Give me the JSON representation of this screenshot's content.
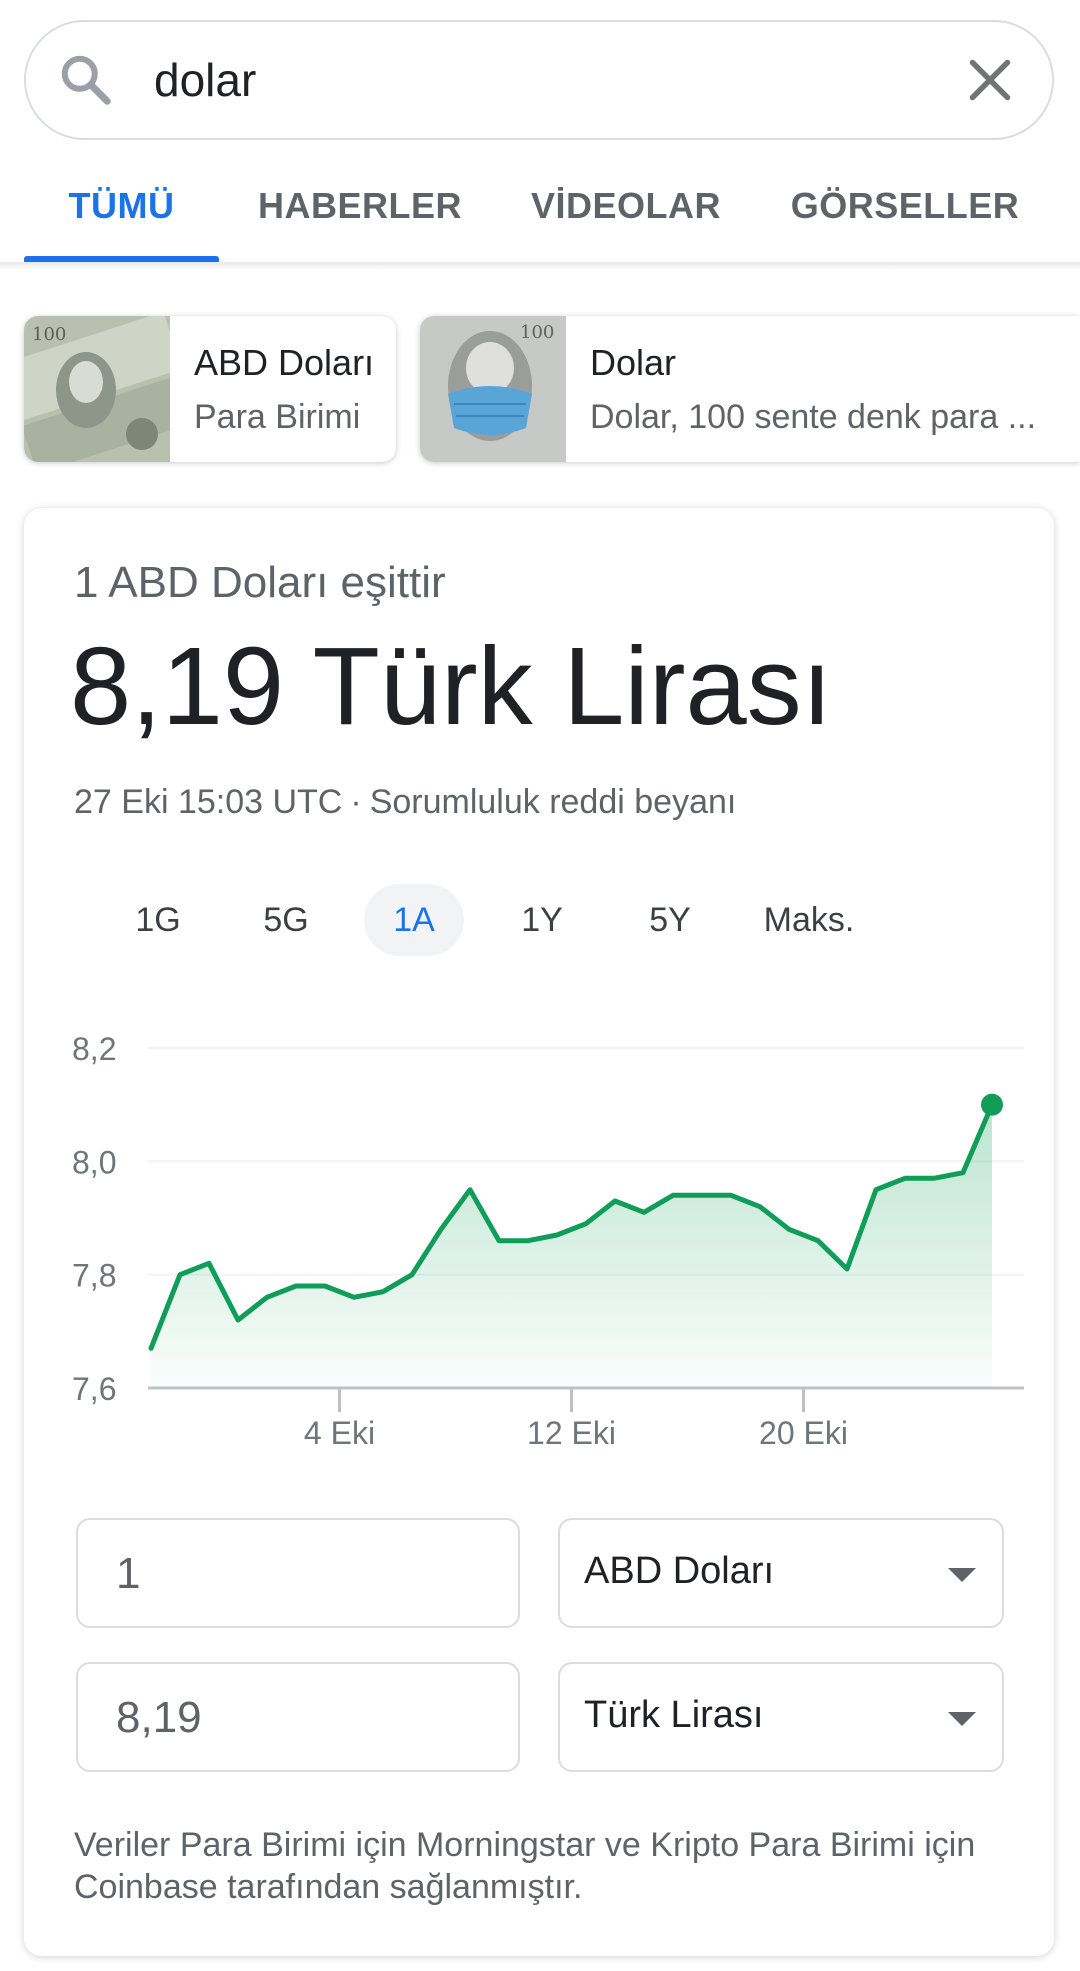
{
  "search": {
    "query": "dolar"
  },
  "tabs": [
    {
      "label": "TÜMÜ",
      "active": true
    },
    {
      "label": "HABERLER",
      "active": false
    },
    {
      "label": "VİDEOLAR",
      "active": false
    },
    {
      "label": "GÖRSELLER",
      "active": false
    }
  ],
  "entities": [
    {
      "title": "ABD Doları",
      "subtitle": "Para Birimi"
    },
    {
      "title": "Dolar",
      "subtitle": "Dolar, 100 sente denk para ..."
    }
  ],
  "converter": {
    "from_line": "1 ABD Doları eşittir",
    "result": "8,19 Türk Lirası",
    "timestamp": "27 Eki 15:03 UTC",
    "separator": "·",
    "disclaimer": "Sorumluluk reddi beyanı",
    "periods": [
      {
        "label": "1G",
        "active": false
      },
      {
        "label": "5G",
        "active": false
      },
      {
        "label": "1A",
        "active": true
      },
      {
        "label": "1Y",
        "active": false
      },
      {
        "label": "5Y",
        "active": false
      },
      {
        "label": "Maks.",
        "active": false
      }
    ],
    "amount_from": "1",
    "currency_from": "ABD Doları",
    "amount_to": "8,19",
    "currency_to": "Türk Lirası",
    "source": "Veriler Para Birimi için Morningstar ve Kripto Para Birimi için Coinbase tarafından sağlanmıştır."
  },
  "colors": {
    "accent": "#1a73e8",
    "chart_line": "#0f9d58"
  },
  "chart_data": {
    "type": "area",
    "title": "",
    "xlabel": "",
    "ylabel": "",
    "ylim": [
      7.6,
      8.2
    ],
    "yticks": [
      "8,2",
      "8,0",
      "7,8",
      "7,6"
    ],
    "ytick_values": [
      8.2,
      8.0,
      7.8,
      7.6
    ],
    "xticks": [
      "4 Eki",
      "12 Eki",
      "20 Eki"
    ],
    "xtick_index": [
      6.5,
      14.5,
      22.5
    ],
    "grid": true,
    "series": [
      {
        "values": [
          7.67,
          7.8,
          7.82,
          7.72,
          7.76,
          7.78,
          7.78,
          7.76,
          7.77,
          7.8,
          7.88,
          7.95,
          7.86,
          7.86,
          7.87,
          7.89,
          7.93,
          7.91,
          7.94,
          7.94,
          7.94,
          7.92,
          7.88,
          7.86,
          7.81,
          7.95,
          7.97,
          7.97,
          7.98,
          8.1
        ]
      }
    ]
  }
}
